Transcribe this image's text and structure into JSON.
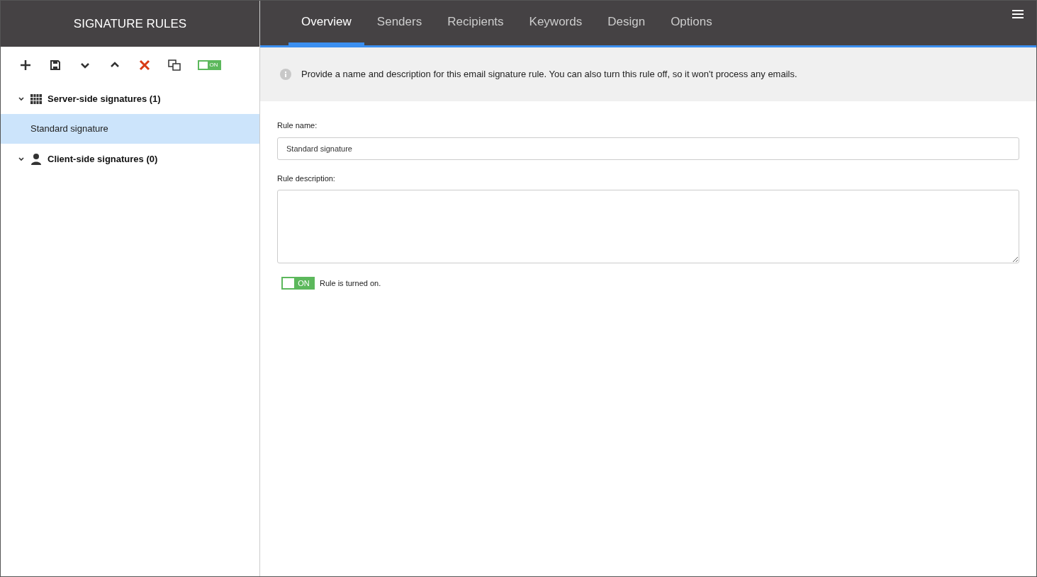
{
  "sidebar": {
    "title": "SIGNATURE RULES",
    "toolbar": [
      {
        "kind": "add"
      },
      {
        "kind": "save"
      },
      {
        "kind": "down"
      },
      {
        "kind": "up"
      },
      {
        "kind": "delete"
      },
      {
        "kind": "copy"
      },
      {
        "kind": "toggle",
        "on": true,
        "label": "ON"
      }
    ],
    "tree": [
      {
        "kind": "server",
        "label": "Server-side signatures (1)",
        "expanded": true,
        "selected": false,
        "children": [
          {
            "label": "Standard signature",
            "selected": true
          }
        ]
      },
      {
        "kind": "client",
        "label": "Client-side signatures (0)",
        "expanded": true,
        "selected": false
      }
    ]
  },
  "tabs": [
    {
      "label": "Overview",
      "selected": true
    },
    {
      "label": "Senders",
      "selected": false
    },
    {
      "label": "Recipients",
      "selected": false
    },
    {
      "label": "Keywords",
      "selected": false
    },
    {
      "label": "Design",
      "selected": false
    },
    {
      "label": "Options",
      "selected": false
    }
  ],
  "info": "Provide a name and description for this email signature rule. You can also turn this rule off, so it won't process any emails.",
  "form": {
    "name_label": "Rule name:",
    "name_value": "Standard signature",
    "description_label": "Rule description:",
    "toggle": {
      "on": true,
      "label": "ON"
    },
    "toggle_text": "Rule is turned on."
  }
}
